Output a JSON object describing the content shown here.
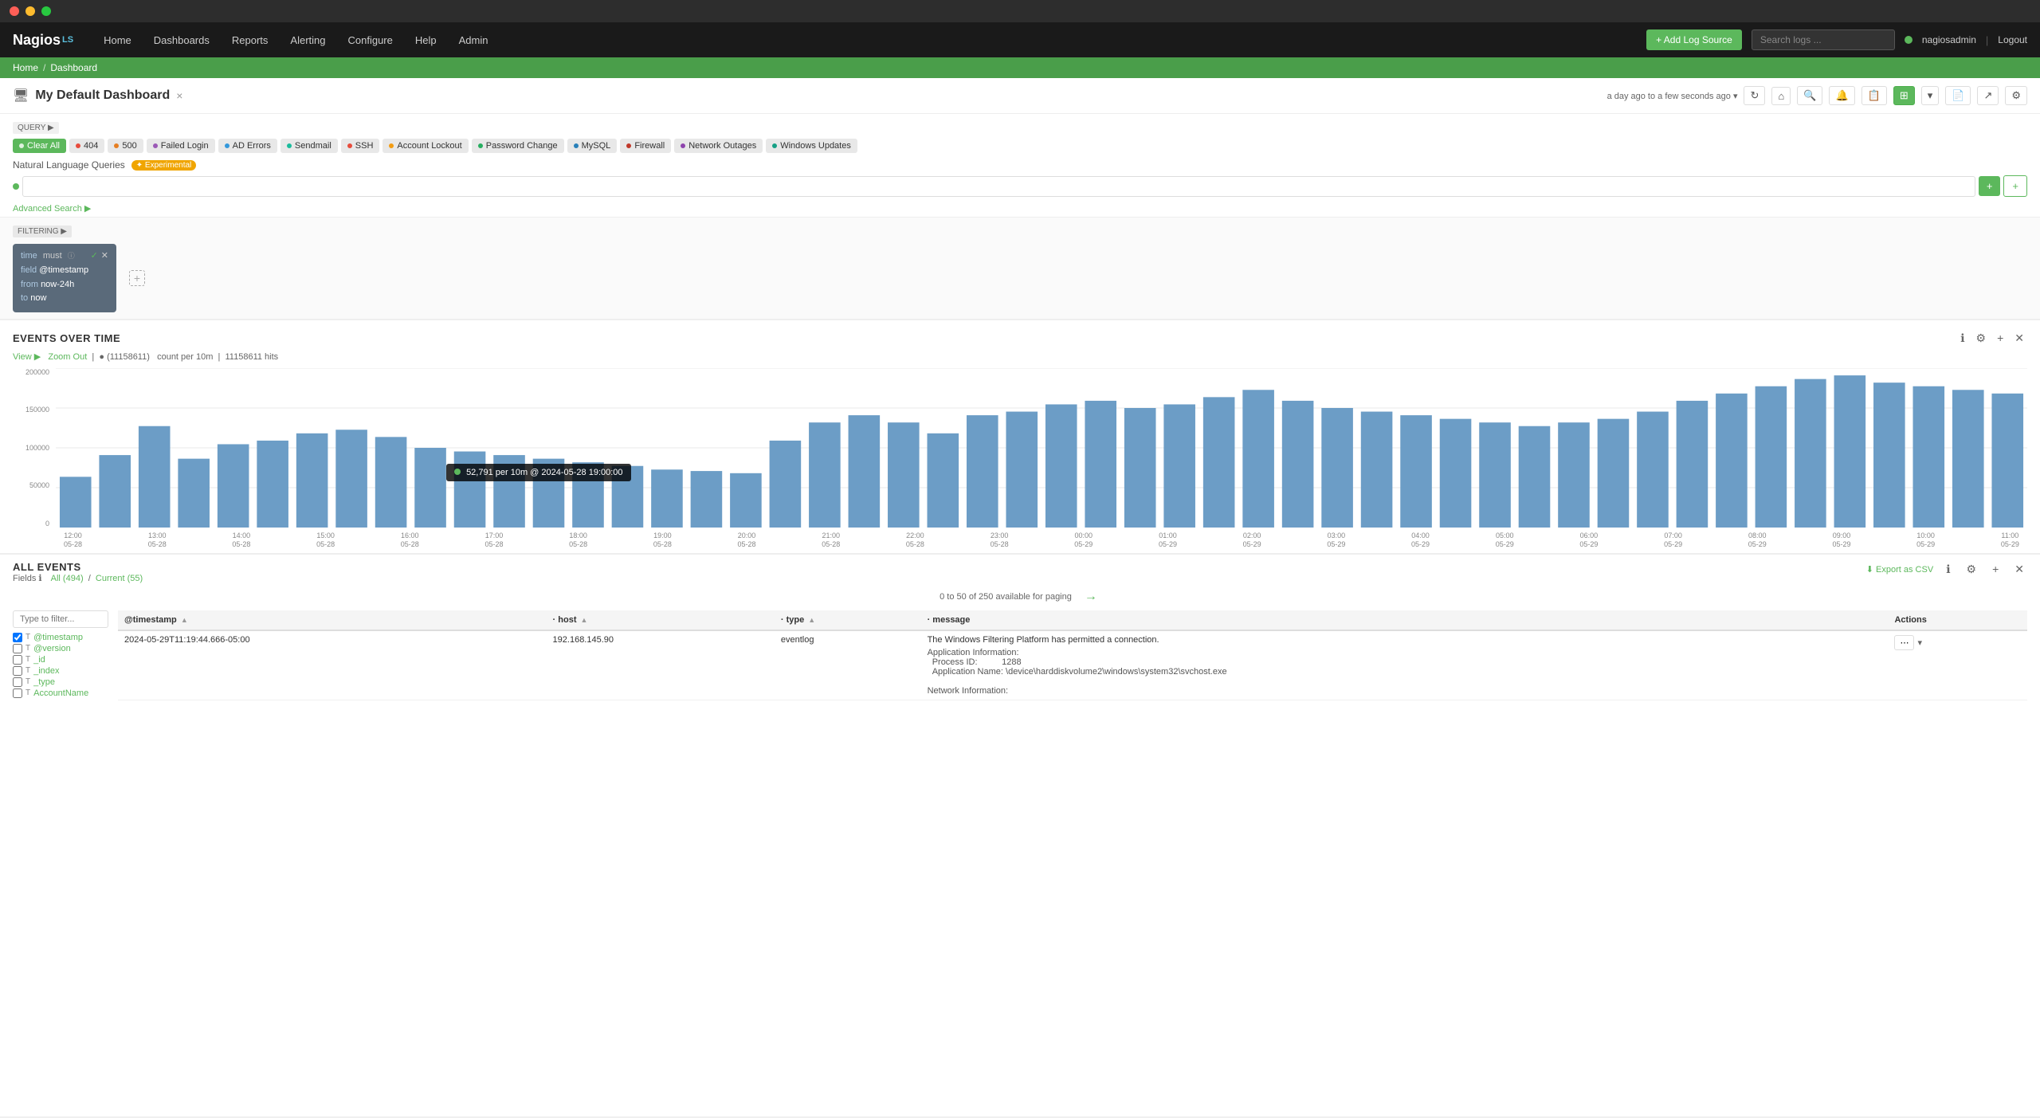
{
  "titleBar": {
    "trafficLights": [
      "red",
      "yellow",
      "green"
    ]
  },
  "navbar": {
    "brand": "Nagios",
    "brandSuffix": "LS",
    "items": [
      "Home",
      "Dashboards",
      "Reports",
      "Alerting",
      "Configure",
      "Help",
      "Admin"
    ],
    "addLogSource": "+ Add Log Source",
    "searchPlaceholder": "Search logs ...",
    "user": "nagiosadmin",
    "logout": "Logout"
  },
  "breadcrumb": {
    "home": "Home",
    "separator": "/",
    "current": "Dashboard"
  },
  "dashboard": {
    "icon": "🖥",
    "title": "My Default Dashboard",
    "closeLabel": "×",
    "timeRange": "a day ago to a few seconds ago ▾",
    "headerButtons": [
      "⌂",
      "🔍",
      "🔔",
      "📋",
      "▦",
      "📄",
      "↗",
      "⚙"
    ]
  },
  "query": {
    "sectionLabel": "QUERY ▶",
    "clearAll": "Clear All",
    "chips": [
      {
        "id": "clear-all",
        "label": "Clear All",
        "dotColor": "#5cb85c",
        "type": "clear"
      },
      {
        "id": "404",
        "label": "404",
        "dotColor": "#e74c3c",
        "type": "filter"
      },
      {
        "id": "500",
        "label": "500",
        "dotColor": "#e67e22",
        "type": "filter"
      },
      {
        "id": "failed-login",
        "label": "Failed Login",
        "dotColor": "#9b59b6",
        "type": "filter"
      },
      {
        "id": "ad-errors",
        "label": "AD Errors",
        "dotColor": "#3498db",
        "type": "filter"
      },
      {
        "id": "sendmail",
        "label": "Sendmail",
        "dotColor": "#1abc9c",
        "type": "filter"
      },
      {
        "id": "ssh",
        "label": "SSH",
        "dotColor": "#e74c3c",
        "type": "filter"
      },
      {
        "id": "account-lockout",
        "label": "Account Lockout",
        "dotColor": "#f39c12",
        "type": "filter"
      },
      {
        "id": "password-change",
        "label": "Password Change",
        "dotColor": "#27ae60",
        "type": "filter"
      },
      {
        "id": "mysql",
        "label": "MySQL",
        "dotColor": "#2980b9",
        "type": "filter"
      },
      {
        "id": "firewall",
        "label": "Firewall",
        "dotColor": "#c0392b",
        "type": "filter"
      },
      {
        "id": "network-outages",
        "label": "Network Outages",
        "dotColor": "#8e44ad",
        "type": "filter"
      },
      {
        "id": "windows-updates",
        "label": "Windows Updates",
        "dotColor": "#16a085",
        "type": "filter"
      }
    ],
    "nlLabel": "Natural Language Queries",
    "nlBadge": "✦ Experimental",
    "nlInputPlaceholder": "",
    "addButtonLabel": "+",
    "plusButtonLabel": "+",
    "advancedSearch": "Advanced Search ▶"
  },
  "filtering": {
    "sectionLabel": "FILTERING ▶",
    "card": {
      "title": "time",
      "must": "must",
      "field": "@timestamp",
      "from": "now-24h",
      "to": "now"
    }
  },
  "eventsOverTime": {
    "title": "EVENTS OVER TIME",
    "viewLabel": "View ▶",
    "zoomOut": "Zoom Out",
    "totalHits": "11158611",
    "perInterval": "count per 10m",
    "allHits": "11158611 hits",
    "yLabels": [
      "200000",
      "150000",
      "100000",
      "50000",
      "0"
    ],
    "tooltip": {
      "value": "52,791 per 10m @ 2024-05-28 19:00:00",
      "dot": true
    },
    "xLabels": [
      {
        "time": "12:00",
        "date": "05-28"
      },
      {
        "time": "13:00",
        "date": "05-28"
      },
      {
        "time": "14:00",
        "date": "05-28"
      },
      {
        "time": "15:00",
        "date": "05-28"
      },
      {
        "time": "16:00",
        "date": "05-28"
      },
      {
        "time": "17:00",
        "date": "05-28"
      },
      {
        "time": "18:00",
        "date": "05-28"
      },
      {
        "time": "19:00",
        "date": "05-28"
      },
      {
        "time": "20:00",
        "date": "05-28"
      },
      {
        "time": "21:00",
        "date": "05-28"
      },
      {
        "time": "22:00",
        "date": "05-28"
      },
      {
        "time": "23:00",
        "date": "05-28"
      },
      {
        "time": "00:00",
        "date": "05-29"
      },
      {
        "time": "01:00",
        "date": "05-29"
      },
      {
        "time": "02:00",
        "date": "05-29"
      },
      {
        "time": "03:00",
        "date": "05-29"
      },
      {
        "time": "04:00",
        "date": "05-29"
      },
      {
        "time": "05:00",
        "date": "05-29"
      },
      {
        "time": "06:00",
        "date": "05-29"
      },
      {
        "time": "07:00",
        "date": "05-29"
      },
      {
        "time": "08:00",
        "date": "05-29"
      },
      {
        "time": "09:00",
        "date": "05-29"
      },
      {
        "time": "10:00",
        "date": "05-29"
      },
      {
        "time": "11:00",
        "date": "05-29"
      }
    ],
    "barData": [
      70,
      100,
      140,
      95,
      115,
      120,
      130,
      135,
      125,
      110,
      105,
      100,
      95,
      90,
      85,
      80,
      78,
      75,
      120,
      145,
      155,
      145,
      130,
      155,
      160,
      170,
      175,
      165,
      170,
      180,
      190,
      175,
      165,
      160,
      155,
      150,
      145,
      140,
      145,
      150,
      160,
      175,
      185,
      195,
      205,
      210,
      200,
      195,
      190,
      185
    ]
  },
  "allEvents": {
    "title": "ALL EVENTS",
    "fieldsLabel": "Fields ℹ",
    "countAll": "All (494)",
    "countCurrent": "Current (55)",
    "paginationText": "0 to 50 of 250 available for paging",
    "exportLabel": "⬇ Export as CSV",
    "filterPlaceholder": "Type to filter...",
    "fields": [
      {
        "name": "@timestamp",
        "checked": true,
        "type": "T"
      },
      {
        "name": "@version",
        "checked": false,
        "type": "T"
      },
      {
        "name": "_id",
        "checked": false,
        "type": "T"
      },
      {
        "name": "_index",
        "checked": false,
        "type": "T"
      },
      {
        "name": "_type",
        "checked": false,
        "type": "T"
      },
      {
        "name": "AccountName",
        "checked": false,
        "type": "T"
      }
    ],
    "columns": [
      "@timestamp",
      "host",
      "type",
      "message",
      "Actions"
    ],
    "rows": [
      {
        "timestamp": "2024-05-29T11:19:44.666-05:00",
        "host": "192.168.145.90",
        "type": "eventlog",
        "message": "The Windows Filtering Platform has permitted a connection.\n\nApplication Information:\n  Process ID: 1288\n  Application Name: \\device\\harddiskvolume2\\windows\\system32\\svchost.exe\n\nNetwork Information:"
      }
    ]
  }
}
